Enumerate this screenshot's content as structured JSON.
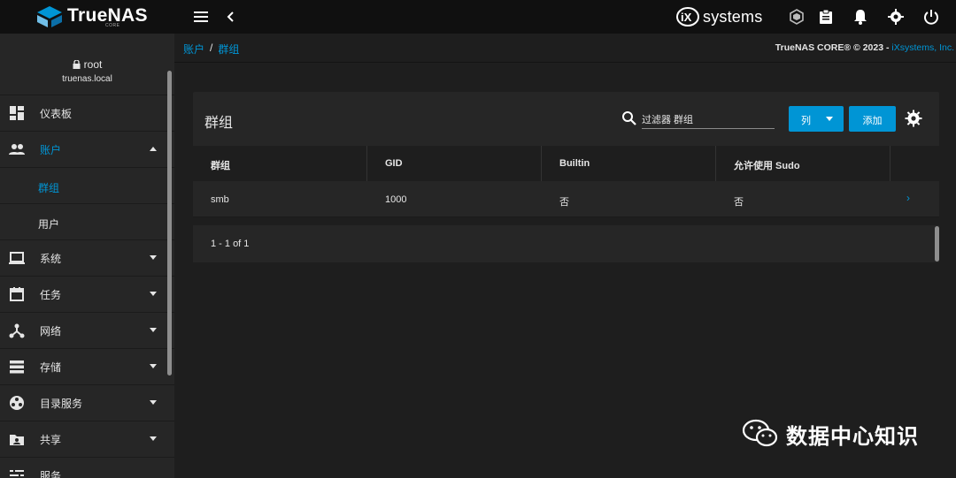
{
  "header": {
    "logo_text": "TrueNAS",
    "logo_sub": "CORE",
    "brand_text": "systems",
    "colors": {
      "accent": "#0095d5",
      "topbar": "#101010"
    }
  },
  "sidebar": {
    "user": {
      "name": "root",
      "host": "truenas.local"
    },
    "items": [
      {
        "label": "仪表板",
        "icon": "dashboard-icon"
      },
      {
        "label": "账户",
        "icon": "people-icon",
        "expanded": true
      },
      {
        "label": "系统",
        "icon": "laptop-icon"
      },
      {
        "label": "任务",
        "icon": "calendar-icon"
      },
      {
        "label": "网络",
        "icon": "network-icon"
      },
      {
        "label": "存储",
        "icon": "storage-icon"
      },
      {
        "label": "目录服务",
        "icon": "directory-icon"
      },
      {
        "label": "共享",
        "icon": "share-icon"
      },
      {
        "label": "服务",
        "icon": "services-icon"
      }
    ],
    "subitems": [
      {
        "label": "群组",
        "active": true
      },
      {
        "label": "用户"
      }
    ]
  },
  "breadcrumb": {
    "items": [
      "账户",
      "群组"
    ],
    "separator": "/"
  },
  "copyright": {
    "text": "TrueNAS CORE® © 2023 - ",
    "link": "iXsystems, Inc."
  },
  "card": {
    "title": "群组",
    "filter_placeholder": "过滤器 群组",
    "columns_button": "列",
    "add_button": "添加",
    "headers": [
      "群组",
      "GID",
      "Builtin",
      "允许使用 Sudo"
    ],
    "rows": [
      {
        "group": "smb",
        "gid": "1000",
        "builtin": "否",
        "sudo": "否",
        "expand": "›"
      }
    ],
    "pager": "1 - 1 of 1"
  },
  "watermark": {
    "text": "数据中心知识"
  }
}
